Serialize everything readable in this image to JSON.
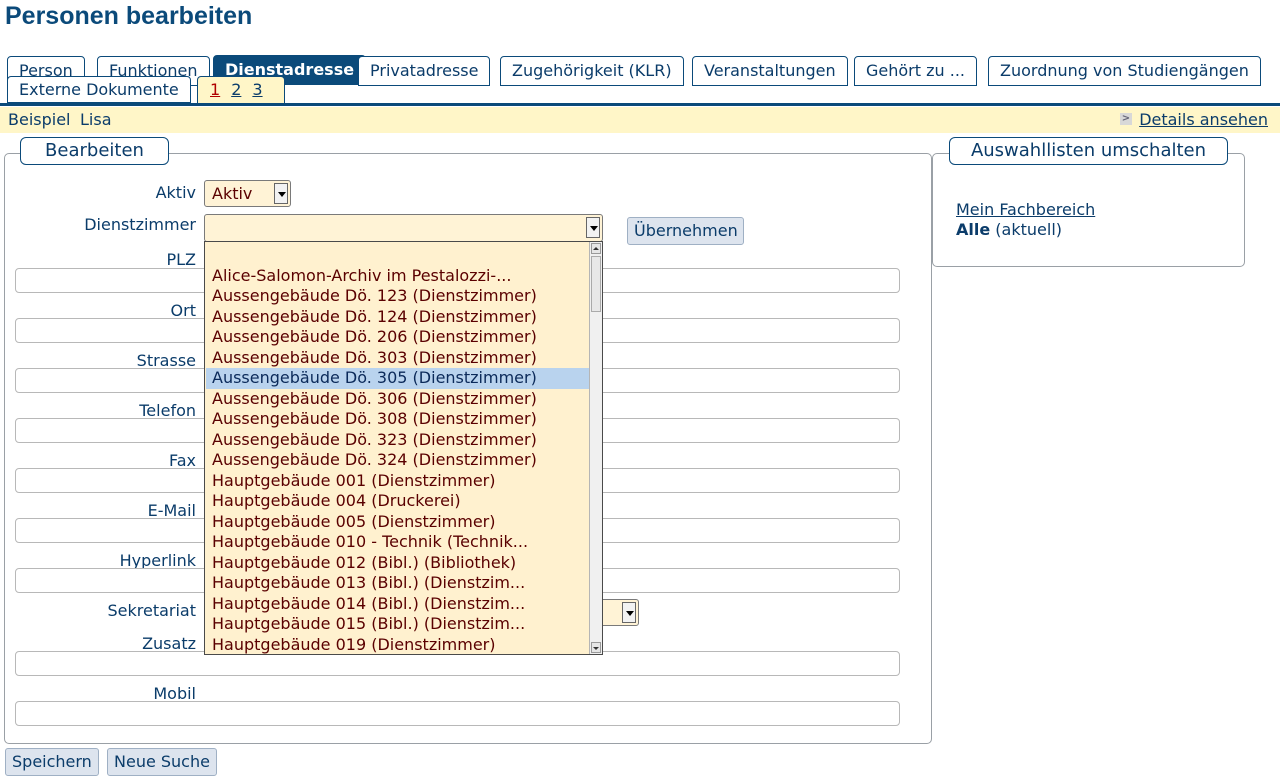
{
  "page": {
    "title": "Personen bearbeiten"
  },
  "tabs": {
    "row1": [
      "Person",
      "Funktionen",
      "Dienstadresse",
      "Privatadresse",
      "Zugehörigkeit (KLR)",
      "Veranstaltungen",
      "Gehört zu ...",
      "Zuordnung von Studiengängen"
    ],
    "row2": [
      "Externe Dokumente"
    ],
    "active": "Dienstadresse",
    "pages": [
      "1",
      "2",
      "3"
    ],
    "current_page": "1"
  },
  "person": {
    "first": "Beispiel",
    "last": "Lisa"
  },
  "details_link": "Details ansehen",
  "form": {
    "legend": "Bearbeiten",
    "aktiv_label": "Aktiv",
    "aktiv_value": "Aktiv",
    "dienstzimmer_label": "Dienstzimmer",
    "dienstzimmer_value": "",
    "uebernehmen_label": "Übernehmen",
    "plz_label": "PLZ",
    "ort_label": "Ort",
    "strasse_label": "Strasse",
    "telefon_label": "Telefon",
    "fax_label": "Fax",
    "email_label": "E-Mail",
    "hyperlink_label": "Hyperlink",
    "sekretariat_label": "Sekretariat",
    "zusatz_label": "Zusatz",
    "mobil_label": "Mobil"
  },
  "dropdown": {
    "selected_index": 6,
    "options": [
      "",
      "Alice-Salomon-Archiv im Pestalozzi-...",
      "Aussengebäude Dö. 123 (Dienstzimmer)",
      "Aussengebäude Dö. 124 (Dienstzimmer)",
      "Aussengebäude Dö. 206 (Dienstzimmer)",
      "Aussengebäude Dö. 303 (Dienstzimmer)",
      "Aussengebäude Dö. 305 (Dienstzimmer)",
      "Aussengebäude Dö. 306 (Dienstzimmer)",
      "Aussengebäude Dö. 308 (Dienstzimmer)",
      "Aussengebäude Dö. 323 (Dienstzimmer)",
      "Aussengebäude Dö. 324 (Dienstzimmer)",
      "Hauptgebäude 001 (Dienstzimmer)",
      "Hauptgebäude 004 (Druckerei)",
      "Hauptgebäude 005 (Dienstzimmer)",
      "Hauptgebäude 010 - Technik (Technik...",
      "Hauptgebäude 012 (Bibl.) (Bibliothek)",
      "Hauptgebäude 013 (Bibl.) (Dienstzim...",
      "Hauptgebäude 014 (Bibl.) (Dienstzim...",
      "Hauptgebäude 015 (Bibl.) (Dienstzim...",
      "Hauptgebäude 019 (Dienstzimmer)"
    ]
  },
  "side": {
    "legend": "Auswahllisten umschalten",
    "mein_fachbereich": "Mein Fachbereich",
    "alle": "Alle",
    "aktuell": "(aktuell)"
  },
  "buttons": {
    "save": "Speichern",
    "new_search": "Neue Suche"
  },
  "colors": {
    "accent": "#0b4a7a",
    "highlight": "#fff6c8",
    "dropdown_bg": "#fff1cf",
    "selected": "#b9d3ee"
  }
}
